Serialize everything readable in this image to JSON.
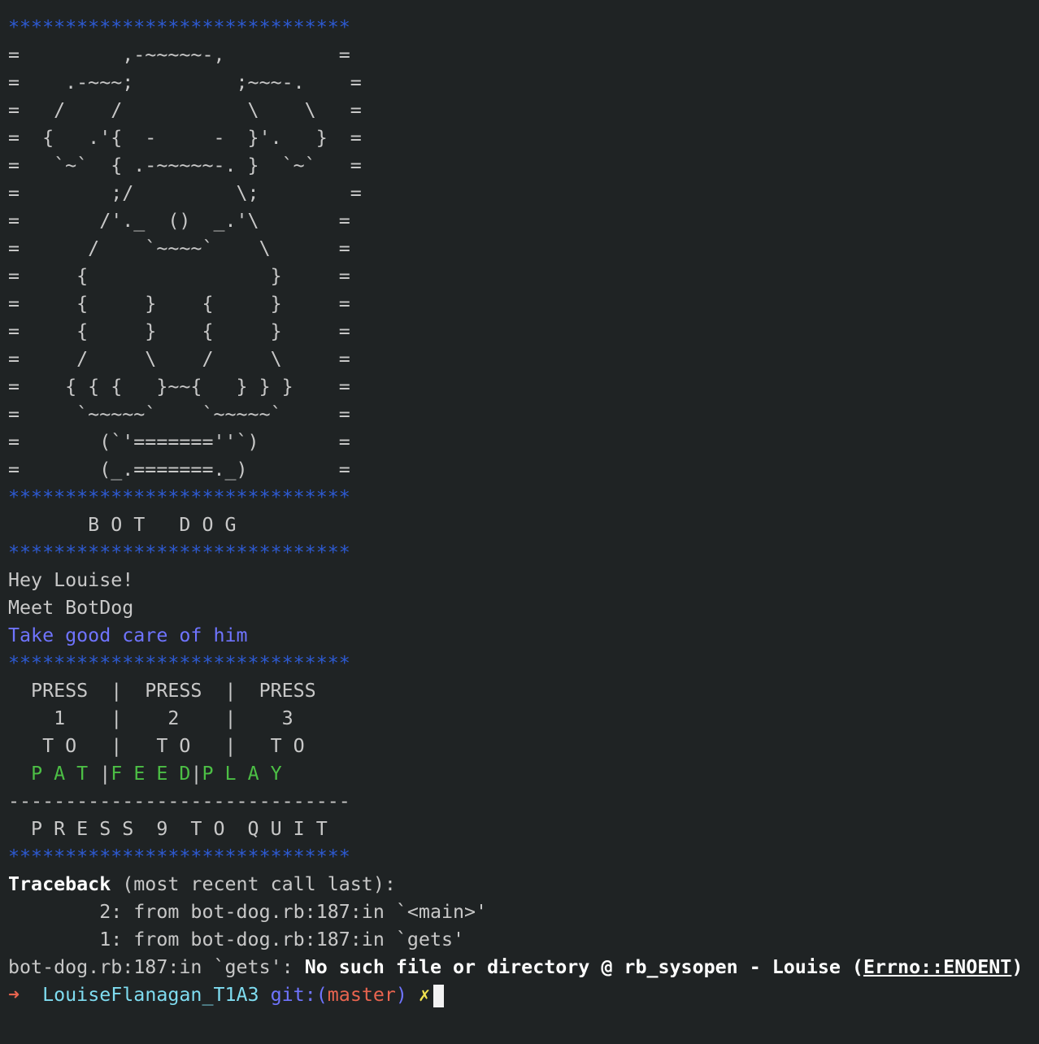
{
  "stars": "******************************",
  "ascii_art": [
    "=         ,-~~~~~-,          =",
    "=    .-~~~;         ;~~~-.    =",
    "=   /    /           \\    \\   =",
    "=  {   .'{  -     -  }'.   }  =",
    "=   `~`  { .-~~~~~-. }  `~`   =",
    "=        ;/         \\;        =",
    "=       /'._  ()  _.'\\       =",
    "=      /    `~~~~`    \\      =",
    "=     {                }     =",
    "=     {     }    {     }     =",
    "=     {     }    {     }     =",
    "=     /     \\    /     \\     =",
    "=    { { {   }~~{   } } }    =",
    "=     `~~~~~`    `~~~~~`     =",
    "=       (`'=======''`)       =",
    "=       (_.=======._)        ="
  ],
  "title": "       B O T   D O G",
  "greeting": "Hey Louise!",
  "meet": "Meet BotDog",
  "care": "Take good care of him",
  "menu": {
    "row_press": "  PRESS  |  PRESS  |  PRESS",
    "row_numbers": "    1    |    2    |    3",
    "row_to": "   T O   |   T O   |   T O",
    "opt_pat": "P A T",
    "opt_feed": "F E E D",
    "opt_play": "P L A Y",
    "divider": "------------------------------",
    "quit": "  P R E S S  9  T O  Q U I T"
  },
  "traceback": {
    "header_bold": "Traceback",
    "header_rest": " (most recent call last):",
    "frame2": "        2: from bot-dog.rb:187:in `<main>'",
    "frame1": "        1: from bot-dog.rb:187:in `gets'",
    "error_loc": "bot-dog.rb:187:in `gets': ",
    "error_msg": "No such file or directory @ rb_sysopen - Louise (",
    "error_class": "Errno::ENOENT",
    "error_close": ")"
  },
  "prompt": {
    "arrow": "➜",
    "directory": "LouiseFlanagan_T1A3",
    "git_label": "git:(",
    "branch": "master",
    "git_close": ")",
    "dirty_mark": "✗"
  },
  "colors": {
    "background": "#1f2324",
    "stars": "#2d5ad2",
    "highlight_blue": "#6f74ff",
    "green": "#4cbf45",
    "prompt_red": "#e8644f",
    "prompt_cyan": "#7fdcf0",
    "prompt_yellow": "#f2e24f"
  }
}
